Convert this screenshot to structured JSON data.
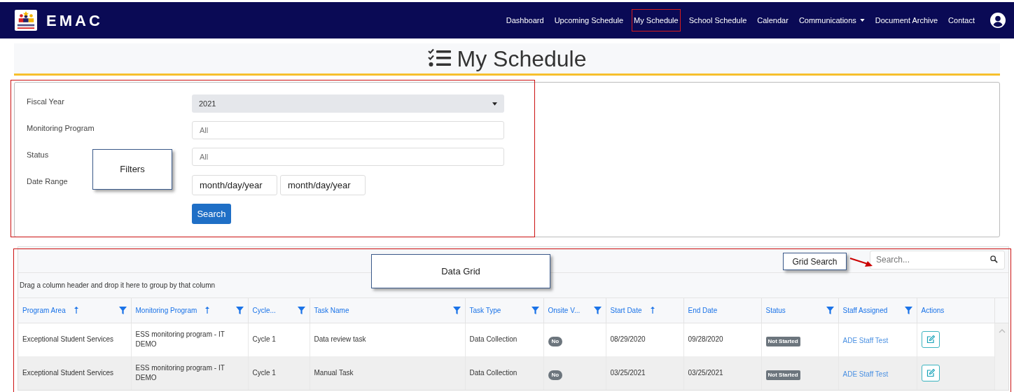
{
  "header": {
    "brand": "EMAC",
    "nav": [
      {
        "label": "Dashboard",
        "selected": false,
        "dropdown": false
      },
      {
        "label": "Upcoming Schedule",
        "selected": false,
        "dropdown": false
      },
      {
        "label": "My Schedule",
        "selected": true,
        "dropdown": false
      },
      {
        "label": "School Schedule",
        "selected": false,
        "dropdown": false
      },
      {
        "label": "Calendar",
        "selected": false,
        "dropdown": false
      },
      {
        "label": "Communications",
        "selected": false,
        "dropdown": true
      },
      {
        "label": "Document Archive",
        "selected": false,
        "dropdown": false
      },
      {
        "label": "Contact",
        "selected": false,
        "dropdown": false
      }
    ]
  },
  "page_title": "My Schedule",
  "filters": [
    {
      "label": "Fiscal Year",
      "kind": "select",
      "value": "2021"
    },
    {
      "label": "Monitoring Program",
      "kind": "input",
      "placeholder": "All"
    },
    {
      "label": "Status",
      "kind": "input",
      "placeholder": "All"
    },
    {
      "label": "Date Range",
      "kind": "dates",
      "values": [
        "month/day/year",
        "month/day/year"
      ]
    }
  ],
  "search_button": "Search",
  "grid": {
    "search_placeholder": "Search...",
    "group_hint": "Drag a column header and drop it here to group by that column",
    "columns": [
      {
        "label": "Program Area",
        "sorted": true,
        "filter": true
      },
      {
        "label": "Monitoring Program",
        "sorted": true,
        "filter": true
      },
      {
        "label": "Cycle...",
        "sorted": false,
        "filter": true
      },
      {
        "label": "Task Name",
        "sorted": false,
        "filter": true
      },
      {
        "label": "Task Type",
        "sorted": false,
        "filter": true
      },
      {
        "label": "Onsite V...",
        "sorted": false,
        "filter": true
      },
      {
        "label": "Start Date",
        "sorted": true,
        "filter": false
      },
      {
        "label": "End Date",
        "sorted": false,
        "filter": false
      },
      {
        "label": "Status",
        "sorted": false,
        "filter": true
      },
      {
        "label": "Staff Assigned",
        "sorted": false,
        "filter": true
      },
      {
        "label": "Actions",
        "sorted": false,
        "filter": false
      }
    ],
    "rows": [
      {
        "cells": [
          {
            "kind": "text",
            "text": "Exceptional Student Services"
          },
          {
            "kind": "text",
            "text": "ESS monitoring program - IT DEMO"
          },
          {
            "kind": "text",
            "text": "Cycle 1"
          },
          {
            "kind": "text",
            "text": "Data review task"
          },
          {
            "kind": "text",
            "text": "Data Collection"
          },
          {
            "kind": "pill",
            "text": "No"
          },
          {
            "kind": "text",
            "text": "08/29/2020"
          },
          {
            "kind": "text",
            "text": "09/28/2020"
          },
          {
            "kind": "status",
            "text": "Not Started"
          },
          {
            "kind": "link",
            "text": "ADE Staff Test"
          },
          {
            "kind": "edit"
          }
        ]
      },
      {
        "cells": [
          {
            "kind": "text",
            "text": "Exceptional Student Services"
          },
          {
            "kind": "text",
            "text": "ESS monitoring program - IT DEMO"
          },
          {
            "kind": "text",
            "text": "Cycle 1"
          },
          {
            "kind": "text",
            "text": "Manual Task"
          },
          {
            "kind": "text",
            "text": "Data Collection"
          },
          {
            "kind": "pill",
            "text": "No"
          },
          {
            "kind": "text",
            "text": "03/25/2021"
          },
          {
            "kind": "text",
            "text": "03/25/2021"
          },
          {
            "kind": "status",
            "text": "Not Started"
          },
          {
            "kind": "link",
            "text": "ADE Staff Test"
          },
          {
            "kind": "edit"
          }
        ]
      }
    ]
  },
  "annotations": [
    {
      "kind": "filters",
      "text": "Filters"
    },
    {
      "kind": "grid",
      "text": "Data Grid"
    },
    {
      "kind": "search",
      "text": "Grid Search"
    }
  ]
}
